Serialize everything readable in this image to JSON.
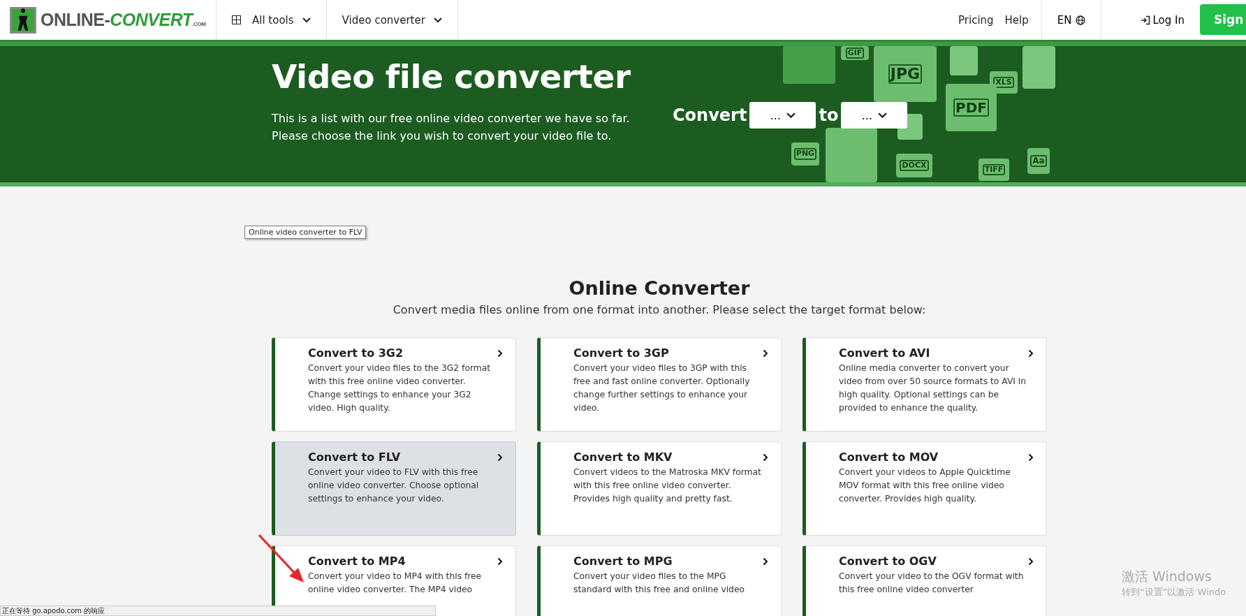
{
  "header": {
    "logo": {
      "word": "ONLINE-",
      "accent": "CONVERT",
      "suffix": ".COM"
    },
    "nav": [
      {
        "label": "All tools"
      },
      {
        "label": "Video converter"
      }
    ],
    "links": [
      "Pricing",
      "Help"
    ],
    "language": "EN",
    "login": "Log In",
    "signup": "Sign"
  },
  "hero": {
    "title": "Video file converter",
    "subtitle": [
      "This is a list with our free online video converter we have so far.",
      "Please choose the link you wish to convert your video file to."
    ],
    "convert_label": "Convert",
    "to_label": "to",
    "from_select": "...",
    "to_select": "...",
    "file_icons": [
      "GIF",
      "JPG",
      "XLS",
      "PDF",
      "PNG",
      "DOCX",
      "TIFF",
      "Aa"
    ]
  },
  "tooltip": "Online video converter to FLV",
  "section": {
    "title": "Online Converter",
    "subtitle": "Convert media files online from one format into another. Please select the target format below:"
  },
  "cards": [
    {
      "title": "Convert to 3G2",
      "text": "Convert your video files to the 3G2 format with this free online video converter. Change settings to enhance your 3G2 video. High quality.",
      "hovered": false
    },
    {
      "title": "Convert to 3GP",
      "text": "Convert your video files to 3GP with this free and fast online converter. Optionally change further settings to enhance your video.",
      "hovered": false
    },
    {
      "title": "Convert to AVI",
      "text": "Online media converter to convert your video from over 50 source formats to AVI in high quality. Optional settings can be provided to enhance the quality.",
      "hovered": false
    },
    {
      "title": "Convert to FLV",
      "text": "Convert your video to FLV with this free online video converter. Choose optional settings to enhance your video.",
      "hovered": true
    },
    {
      "title": "Convert to MKV",
      "text": "Convert videos to the Matroska MKV format with this free online video converter. Provides high quality and pretty fast.",
      "hovered": false
    },
    {
      "title": "Convert to MOV",
      "text": "Convert your videos to Apple Quicktime MOV format with this free online video converter. Provides high quality.",
      "hovered": false
    },
    {
      "title": "Convert to MP4",
      "text": "Convert your video to MP4 with this free online video converter. The MP4 video",
      "hovered": false
    },
    {
      "title": "Convert to MPG",
      "text": "Convert your video files to the MPG standard with this free and online video",
      "hovered": false
    },
    {
      "title": "Convert to OGV",
      "text": "Convert your video to the OGV format with this free online video converter",
      "hovered": false
    }
  ],
  "status_bar": "正在等待 go.apodo.com 的响应",
  "activation": {
    "title": "激活 Windows",
    "text": "转到“设置”以激活 Windo"
  }
}
